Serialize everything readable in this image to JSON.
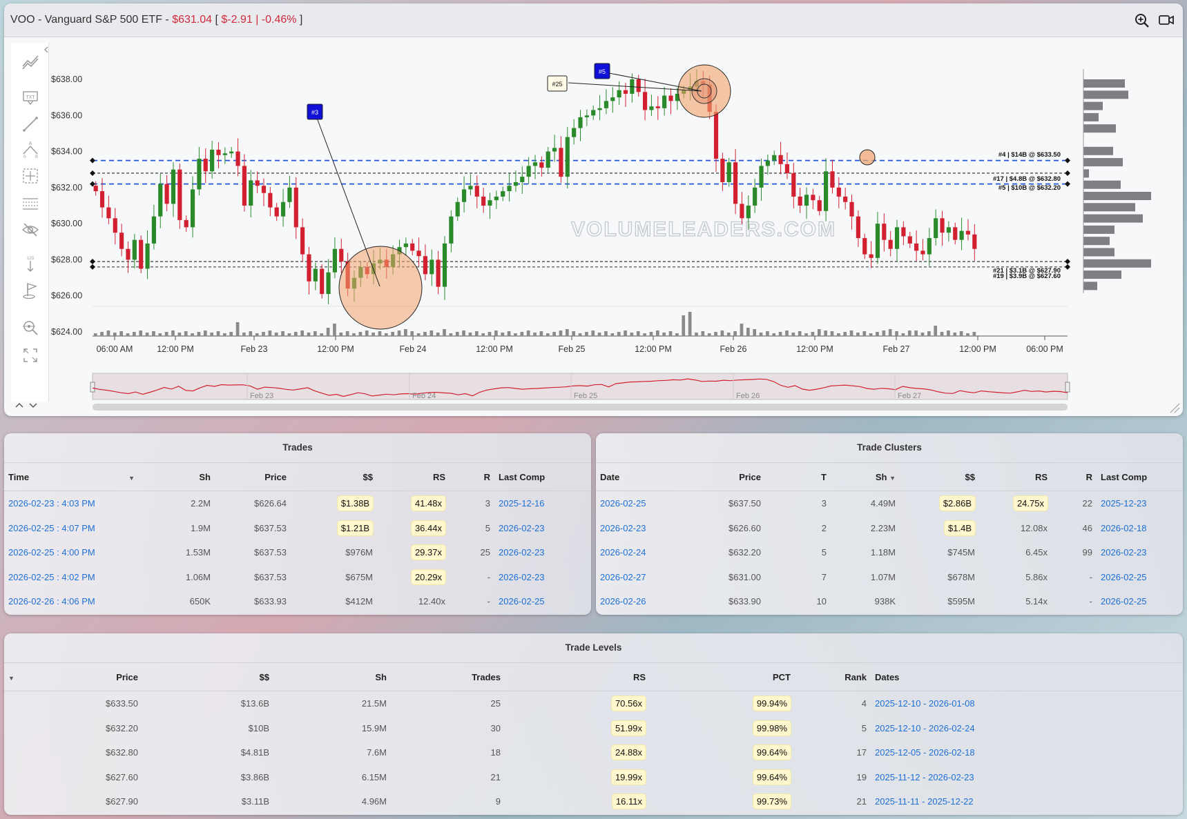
{
  "header": {
    "ticker_name": "VOO - Vanguard S&P 500 ETF - ",
    "price": "$631.04",
    "bracket_open": " [ ",
    "change": "$-2.91 | -0.46%",
    "bracket_close": " ]",
    "icons": [
      "zoom-in-icon",
      "video-camera-icon"
    ]
  },
  "toolbar": {
    "tools": [
      "trend-lines-icon",
      "text-tool-icon",
      "line-tool-icon",
      "path-tool-icon",
      "crosshair-tool-icon",
      "grid-lines-icon",
      "hide-drawings-icon",
      "measure-tool-icon",
      "flag-tool-icon",
      "zoom-reset-icon",
      "fullscreen-icon"
    ],
    "scroll_icons": [
      "chevron-up-icon",
      "chevron-down-icon"
    ]
  },
  "chart": {
    "watermark": "VOLUMELEADERS.COM",
    "y_ticks": [
      "$638.00",
      "$636.00",
      "$634.00",
      "$632.00",
      "$630.00",
      "$628.00",
      "$626.00",
      "$624.00"
    ],
    "x_ticks": [
      "06:00 AM",
      "12:00 PM",
      "Feb 23",
      "12:00 PM",
      "Feb 24",
      "12:00 PM",
      "Feb 25",
      "12:00 PM",
      "Feb 26",
      "12:00 PM",
      "Feb 27",
      "12:00 PM",
      "06:00 PM"
    ],
    "navigator_ticks": [
      "Feb 23",
      "Feb 24",
      "Feb 25",
      "Feb 26",
      "Feb 27"
    ],
    "markers": [
      "#3",
      "#5",
      "#25"
    ],
    "level_labels": [
      "#4 | $14B @ $633.50",
      "#17 | $4.8B @ $632.80",
      "#5 | $10B @ $632.20",
      "#21 | $3.1B @ $627.90",
      "#19 | $3.9B @ $627.60"
    ],
    "colors": {
      "up": "#2a8a2a",
      "down": "#d32030",
      "level_blue": "#1f55d6",
      "level_black": "#222222",
      "cluster": "#f2a36b",
      "marker_blue": "#1010d8"
    }
  },
  "chart_data": {
    "type": "candlestick",
    "y_range": [
      624,
      639
    ],
    "levels": [
      633.5,
      632.8,
      632.2,
      627.9,
      627.6
    ],
    "closes": [
      631.8,
      630.9,
      630.3,
      629.5,
      628.6,
      628.0,
      629.1,
      627.5,
      628.9,
      630.4,
      632.2,
      631.1,
      633.0,
      630.2,
      629.8,
      631.9,
      633.6,
      632.9,
      634.1,
      633.8,
      633.9,
      634.0,
      633.2,
      631.0,
      632.4,
      632.1,
      631.7,
      630.9,
      630.4,
      631.2,
      632.0,
      629.8,
      628.3,
      626.8,
      627.5,
      626.1,
      627.3,
      628.6,
      627.9,
      626.4,
      627.0,
      627.6,
      627.2,
      627.8,
      628.0,
      627.6,
      628.3,
      628.7,
      628.9,
      628.5,
      628.2,
      627.2,
      628.0,
      626.5,
      628.9,
      630.4,
      631.2,
      631.9,
      632.1,
      631.5,
      631.0,
      631.3,
      631.5,
      631.8,
      632.1,
      632.3,
      632.6,
      633.2,
      633.4,
      633.1,
      634.0,
      634.2,
      632.6,
      634.8,
      635.3,
      635.9,
      636.0,
      636.3,
      636.4,
      636.8,
      637.0,
      637.4,
      637.2,
      638.0,
      637.3,
      636.3,
      636.5,
      636.4,
      637.1,
      636.8,
      637.2,
      637.4,
      637.6,
      637.9,
      637.7,
      636.2,
      633.6,
      632.3,
      633.4,
      631.1,
      630.3,
      631.0,
      632.0,
      633.2,
      633.5,
      633.8,
      633.3,
      632.8,
      631.5,
      631.0,
      631.6,
      631.3,
      630.7,
      632.9,
      632.0,
      631.5,
      631.2,
      630.4,
      629.2,
      628.3,
      628.1,
      630.0,
      629.1,
      628.6,
      629.8,
      629.3,
      628.9,
      628.5,
      628.3,
      629.2,
      630.3,
      629.5,
      629.8,
      629.1,
      629.6,
      629.4,
      628.6
    ]
  },
  "trades": {
    "title": "Trades",
    "columns": [
      "Time",
      "Sh",
      "Price",
      "$$",
      "RS",
      "R",
      "Last Comp"
    ],
    "rows": [
      {
        "time": "2026-02-23 : 4:03 PM",
        "sh": "2.2M",
        "price": "$626.64",
        "dollars": "$1.38B",
        "rs": "41.48x",
        "r": "3",
        "last_comp": "2025-12-16"
      },
      {
        "time": "2026-02-25 : 4:07 PM",
        "sh": "1.9M",
        "price": "$637.53",
        "dollars": "$1.21B",
        "rs": "36.44x",
        "r": "5",
        "last_comp": "2026-02-23"
      },
      {
        "time": "2026-02-25 : 4:00 PM",
        "sh": "1.53M",
        "price": "$637.53",
        "dollars": "$976M",
        "rs": "29.37x",
        "r": "25",
        "last_comp": "2026-02-23"
      },
      {
        "time": "2026-02-25 : 4:02 PM",
        "sh": "1.06M",
        "price": "$637.53",
        "dollars": "$675M",
        "rs": "20.29x",
        "r": "-",
        "last_comp": "2026-02-23"
      },
      {
        "time": "2026-02-26 : 4:06 PM",
        "sh": "650K",
        "price": "$633.93",
        "dollars": "$412M",
        "rs": "12.40x",
        "r": "-",
        "last_comp": "2026-02-25"
      }
    ]
  },
  "clusters": {
    "title": "Trade Clusters",
    "columns": [
      "Date",
      "Price",
      "T",
      "Sh",
      "$$",
      "RS",
      "R",
      "Last Comp"
    ],
    "rows": [
      {
        "date": "2026-02-25",
        "price": "$637.50",
        "t": "3",
        "sh": "4.49M",
        "dollars": "$2.86B",
        "rs": "24.75x",
        "r": "22",
        "last_comp": "2025-12-23"
      },
      {
        "date": "2026-02-23",
        "price": "$626.60",
        "t": "2",
        "sh": "2.23M",
        "dollars": "$1.4B",
        "rs": "12.08x",
        "r": "46",
        "last_comp": "2026-02-18"
      },
      {
        "date": "2026-02-24",
        "price": "$632.20",
        "t": "5",
        "sh": "1.18M",
        "dollars": "$745M",
        "rs": "6.45x",
        "r": "99",
        "last_comp": "2026-02-23"
      },
      {
        "date": "2026-02-27",
        "price": "$631.00",
        "t": "7",
        "sh": "1.07M",
        "dollars": "$678M",
        "rs": "5.86x",
        "r": "-",
        "last_comp": "2026-02-25"
      },
      {
        "date": "2026-02-26",
        "price": "$633.90",
        "t": "10",
        "sh": "938K",
        "dollars": "$595M",
        "rs": "5.14x",
        "r": "-",
        "last_comp": "2026-02-25"
      }
    ]
  },
  "levels": {
    "title": "Trade Levels",
    "columns": [
      "Price",
      "$$",
      "Sh",
      "Trades",
      "RS",
      "PCT",
      "Rank",
      "Dates"
    ],
    "rows": [
      {
        "price": "$633.50",
        "dollars": "$13.6B",
        "sh": "21.5M",
        "trades": "25",
        "rs": "70.56x",
        "pct": "99.94%",
        "rank": "4",
        "dates": "2025-12-10 - 2026-01-08"
      },
      {
        "price": "$632.20",
        "dollars": "$10B",
        "sh": "15.9M",
        "trades": "30",
        "rs": "51.99x",
        "pct": "99.98%",
        "rank": "5",
        "dates": "2025-12-10 - 2026-02-24"
      },
      {
        "price": "$632.80",
        "dollars": "$4.81B",
        "sh": "7.6M",
        "trades": "18",
        "rs": "24.88x",
        "pct": "99.64%",
        "rank": "17",
        "dates": "2025-12-05 - 2026-02-18"
      },
      {
        "price": "$627.60",
        "dollars": "$3.86B",
        "sh": "6.15M",
        "trades": "21",
        "rs": "19.99x",
        "pct": "99.64%",
        "rank": "19",
        "dates": "2025-11-12 - 2026-02-23"
      },
      {
        "price": "$627.90",
        "dollars": "$3.11B",
        "sh": "4.96M",
        "trades": "9",
        "rs": "16.11x",
        "pct": "99.73%",
        "rank": "21",
        "dates": "2025-11-11 - 2025-12-22"
      }
    ]
  }
}
